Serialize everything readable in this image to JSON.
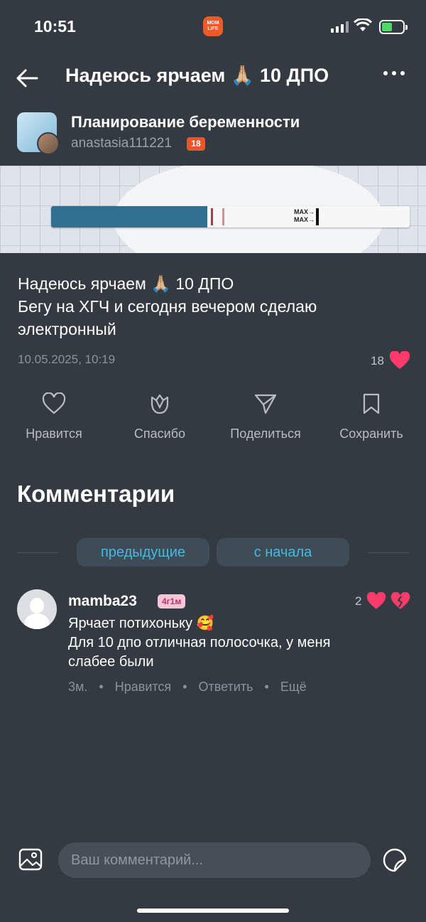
{
  "status_bar": {
    "time": "10:51",
    "app_logo": "MOM LIFE"
  },
  "header": {
    "title": "Надеюсь ярчаем 🙏🏼 10 ДПО",
    "back_icon": "arrow-left-icon",
    "more_icon": "ellipsis-icon"
  },
  "community": {
    "name": "Планирование беременности",
    "username": "anastasia111221",
    "age_badge": "18"
  },
  "post": {
    "line1": "Надеюсь ярчаем 🙏🏼 10 ДПО",
    "line2": "Бегу на ХГЧ и сегодня вечером сделаю",
    "line3": "электронный",
    "date": "10.05.2025, 10:19",
    "likes": "18"
  },
  "actions": [
    {
      "label": "Нравится",
      "icon": "heart-outline-icon"
    },
    {
      "label": "Спасибо",
      "icon": "flower-icon"
    },
    {
      "label": "Поделиться",
      "icon": "send-icon"
    },
    {
      "label": "Сохранить",
      "icon": "bookmark-icon"
    }
  ],
  "comments": {
    "title": "Комментарии",
    "prev_label": "предыдущие",
    "start_label": "с начала",
    "items": [
      {
        "username": "mamba23",
        "badge": "4г1м",
        "likes": "2",
        "line1": "Ярчает потихоньку 🥰",
        "line2": "Для 10 дпо отличная полосочка, у меня",
        "line3": "слабее были",
        "time": "3м.",
        "like_action": "Нравится",
        "reply_action": "Ответить",
        "more_action": "Ещё"
      }
    ]
  },
  "composer": {
    "placeholder": "Ваш комментарий..."
  },
  "colors": {
    "background": "#343a42",
    "accent_blue": "#49b8e0",
    "heart": "#ff3b6b",
    "badge_orange": "#e8562a"
  }
}
